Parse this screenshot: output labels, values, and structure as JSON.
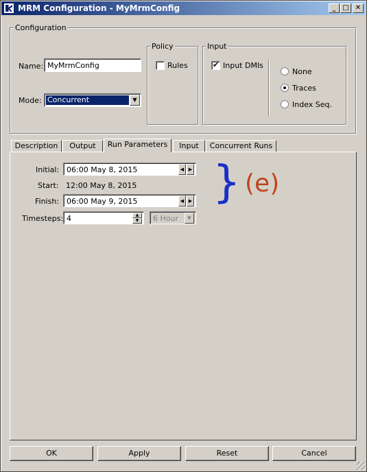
{
  "window": {
    "title": "MRM Configuration - MyMrmConfig"
  },
  "config": {
    "legend": "Configuration",
    "name_label": "Name:",
    "name_value": "MyMrmConfig",
    "mode_label": "Mode:",
    "mode_value": "Concurrent"
  },
  "policy": {
    "legend": "Policy",
    "rules_label": "Rules",
    "rules_checked": false
  },
  "input_group": {
    "legend": "Input",
    "dmis_label": "Input DMIs",
    "dmis_checked": true,
    "radios": [
      {
        "label": "None",
        "selected": false
      },
      {
        "label": "Traces",
        "selected": true
      },
      {
        "label": "Index Seq.",
        "selected": false
      }
    ]
  },
  "tabs": [
    {
      "label": "Description",
      "active": false
    },
    {
      "label": "Output",
      "active": false
    },
    {
      "label": "Run Parameters",
      "active": true
    },
    {
      "label": "Input",
      "active": false
    },
    {
      "label": "Concurrent Runs",
      "active": false
    }
  ],
  "run_params": {
    "initial_label": "Initial:",
    "initial_value": "06:00 May 8, 2015",
    "start_label": "Start:",
    "start_value": "12:00 May 8, 2015",
    "finish_label": "Finish:",
    "finish_value": "06:00 May 9, 2015",
    "timesteps_label": "Timesteps:",
    "timesteps_value": "4",
    "timestep_unit": "6 Hour"
  },
  "annotation": {
    "brace": "}",
    "text": "(e)",
    "brace_color": "#1a2fc8",
    "text_color": "#c0441a"
  },
  "buttons": {
    "ok": "OK",
    "apply": "Apply",
    "reset": "Reset",
    "cancel": "Cancel"
  },
  "colors": {
    "title_bar": "#0a246a",
    "face": "#d4d0c8",
    "selection": "#0a246a"
  }
}
